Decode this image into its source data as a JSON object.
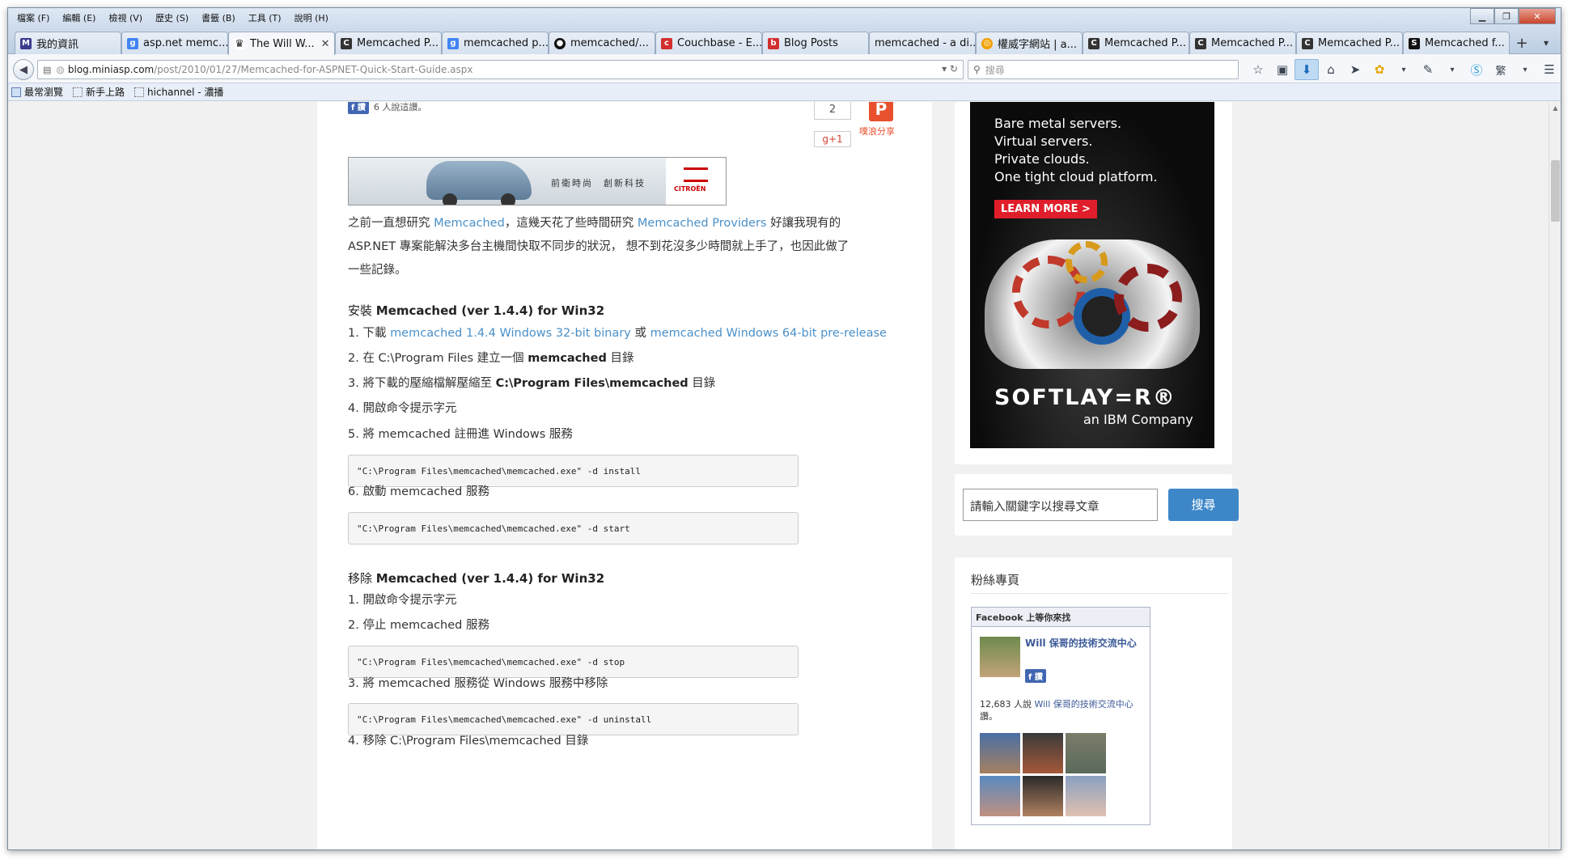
{
  "menu": [
    "檔案 (F)",
    "編輯 (E)",
    "檢視 (V)",
    "歷史 (S)",
    "書籤 (B)",
    "工具 (T)",
    "說明 (H)"
  ],
  "tabs": [
    {
      "label": "我的資訊",
      "icon": "mx-icon",
      "color": "#3b3b8f"
    },
    {
      "label": "asp.net memc...",
      "icon": "google-icon",
      "color": "#4285f4"
    },
    {
      "label": "The Will W...",
      "icon": "will-icon",
      "color": "#222222",
      "active": true
    },
    {
      "label": "Memcached P...",
      "icon": "cd-icon",
      "color": "#333333"
    },
    {
      "label": "memcached p...",
      "icon": "google-icon",
      "color": "#4285f4"
    },
    {
      "label": "memcached/...",
      "icon": "github-icon",
      "color": "#111111"
    },
    {
      "label": "Couchbase - E...",
      "icon": "couchbase-icon",
      "color": "#d32f2f"
    },
    {
      "label": "Blog Posts",
      "icon": "blogger-icon",
      "color": "#d32f2f"
    },
    {
      "label": "memcached - a di...",
      "icon": "none",
      "color": "#cccccc"
    },
    {
      "label": "權威字網站 | a...",
      "icon": "globe-icon",
      "color": "#f2a100"
    },
    {
      "label": "Memcached P...",
      "icon": "cd-icon",
      "color": "#333333"
    },
    {
      "label": "Memcached P...",
      "icon": "cd-icon",
      "color": "#333333"
    },
    {
      "label": "Memcached P...",
      "icon": "cd-icon",
      "color": "#333333"
    },
    {
      "label": "Memcached f...",
      "icon": "s-icon",
      "color": "#111111"
    }
  ],
  "url": {
    "host": "blog.miniasp.com",
    "path": "/post/2010/01/27/Memcached-for-ASPNET-Quick-Start-Guide.aspx"
  },
  "search": {
    "placeholder": "搜尋"
  },
  "bookmarks": [
    "最常瀏覽",
    "新手上路",
    "hichannel - 濃播"
  ],
  "social": {
    "fb_like": "讚",
    "fb_count_text": "6 人說這讚。",
    "count": "2",
    "gplus": "g+1",
    "plurk_label": "噗浪分享"
  },
  "banner": {
    "slogan": "前衛時尚　創新科技",
    "brand": "CITROËN"
  },
  "article": {
    "intro_1": "之前一直想研究 ",
    "intro_link1": "Memcached",
    "intro_2": "，這幾天花了些時間研究 ",
    "intro_link2": "Memcached Providers",
    "intro_3": " 好讓我現有的",
    "intro_line2": "ASP.NET 專案能解決多台主機間快取不同步的狀況， 想不到花沒多少時間就上手了，也因此做了",
    "intro_line3": "一些記錄。",
    "install_heading_pre": "安裝 ",
    "install_heading": "Memcached (ver 1.4.4) for Win32",
    "step1_pre": "1. 下載 ",
    "step1_link1": "memcached 1.4.4 Windows 32-bit binary",
    "step1_mid": " 或 ",
    "step1_link2": "memcached Windows 64-bit pre-release",
    "step2_pre": "2. 在 C:\\Program Files 建立一個 ",
    "step2_bold": "memcached",
    "step2_post": " 目錄",
    "step3_pre": "3. 將下載的壓縮檔解壓縮至 ",
    "step3_bold": "C:\\Program Files\\memcached",
    "step3_post": " 目錄",
    "step4": "4. 開啟命令提示字元",
    "step5": "5. 將 memcached 註冊進 Windows 服務",
    "code1": "\"C:\\Program Files\\memcached\\memcached.exe\" -d install",
    "step6": "6. 啟動 memcached 服務",
    "code2": "\"C:\\Program Files\\memcached\\memcached.exe\" -d start",
    "remove_heading_pre": "移除 ",
    "remove_heading": "Memcached (ver 1.4.4) for Win32",
    "r1": "1. 開啟命令提示字元",
    "r2": "2. 停止 memcached 服務",
    "code3": "\"C:\\Program Files\\memcached\\memcached.exe\" -d stop",
    "r3": "3. 將 memcached 服務從 Windows 服務中移除",
    "code4": "\"C:\\Program Files\\memcached\\memcached.exe\" -d uninstall",
    "r4": "4. 移除 C:\\Program Files\\memcached 目錄"
  },
  "ad": {
    "lines": [
      "Bare metal servers.",
      "Virtual servers.",
      "Private clouds.",
      "One tight cloud platform."
    ],
    "cta": "LEARN MORE >",
    "brand": "SOFTLAY=R®",
    "sub": "an IBM Company"
  },
  "sidebar": {
    "search_placeholder": "請輸入關鍵字以搜尋文章",
    "search_button": "搜尋",
    "fans_title": "粉絲專頁",
    "fb_header": "Facebook 上等你來找",
    "page_name": "Will 保哥的技術交流中心",
    "like_button": "讚",
    "likes_pre": "12,683 人說 ",
    "likes_link": "Will 保哥的技術交流中心",
    "likes_post": "讚。"
  }
}
